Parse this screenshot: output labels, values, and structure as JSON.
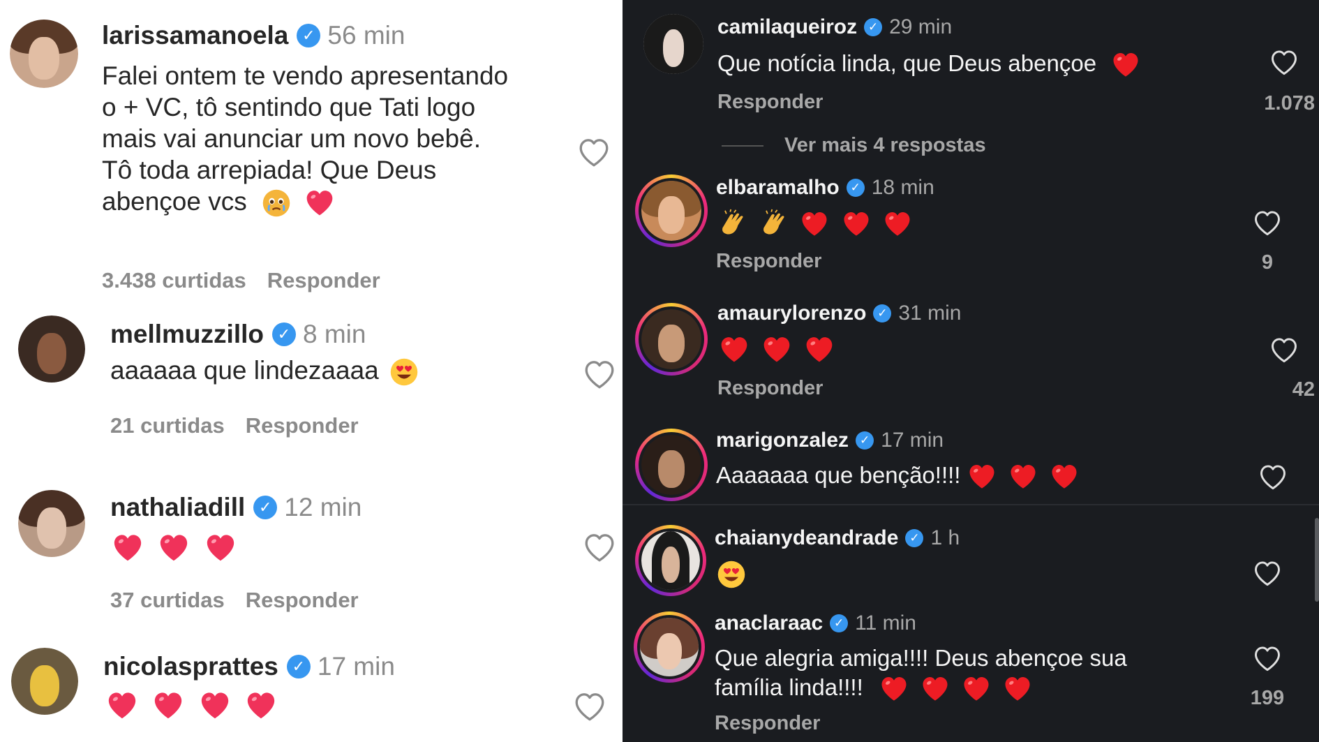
{
  "left_panel": {
    "comments": [
      {
        "username": "larissamanoela",
        "time": "56 min",
        "text_lines": [
          "Falei ontem te vendo apresentando",
          "o + VC, tô sentindo que Tati logo",
          "mais vai anunciar um novo bebê.",
          "Tô toda arrepiada! Que Deus",
          "abençoe vcs"
        ],
        "likes": "3.438 curtidas",
        "reply": "Responder"
      },
      {
        "username": "mellmuzzillo",
        "time": "8 min",
        "text": "aaaaaa que lindezaaaa",
        "likes": "21 curtidas",
        "reply": "Responder"
      },
      {
        "username": "nathaliadill",
        "time": "12 min",
        "likes": "37 curtidas",
        "reply": "Responder"
      },
      {
        "username": "nicolasprattes",
        "time": "17 min"
      }
    ]
  },
  "right_panel": {
    "comments": [
      {
        "username": "camilaqueiroz",
        "time": "29 min",
        "text": "Que notícia linda, que Deus abençoe",
        "reply": "Responder",
        "like_count": "1.078"
      },
      {
        "username": "elbaramalho",
        "time": "18 min",
        "reply": "Responder",
        "like_count": "9"
      },
      {
        "username": "amaurylorenzo",
        "time": "31 min",
        "reply": "Responder",
        "like_count": "42"
      },
      {
        "username": "marigonzalez",
        "time": "17 min",
        "text": "Aaaaaaa que benção!!!!"
      },
      {
        "username": "chaianydeandrade",
        "time": "1 h"
      },
      {
        "username": "anaclaraac",
        "time": "11 min",
        "text_lines": [
          "Que alegria amiga!!!! Deus abençoe sua",
          "família linda!!!!"
        ],
        "reply": "Responder",
        "like_count": "199"
      }
    ],
    "view_more_replies": "Ver mais 4 respostas"
  },
  "icons": {
    "verified": "verified-badge-icon",
    "like": "heart-outline-icon"
  },
  "colors": {
    "light_bg": "#ffffff",
    "dark_bg": "#1a1c20",
    "verified_blue": "#3797f0",
    "heart_red": "#ed1c24"
  }
}
